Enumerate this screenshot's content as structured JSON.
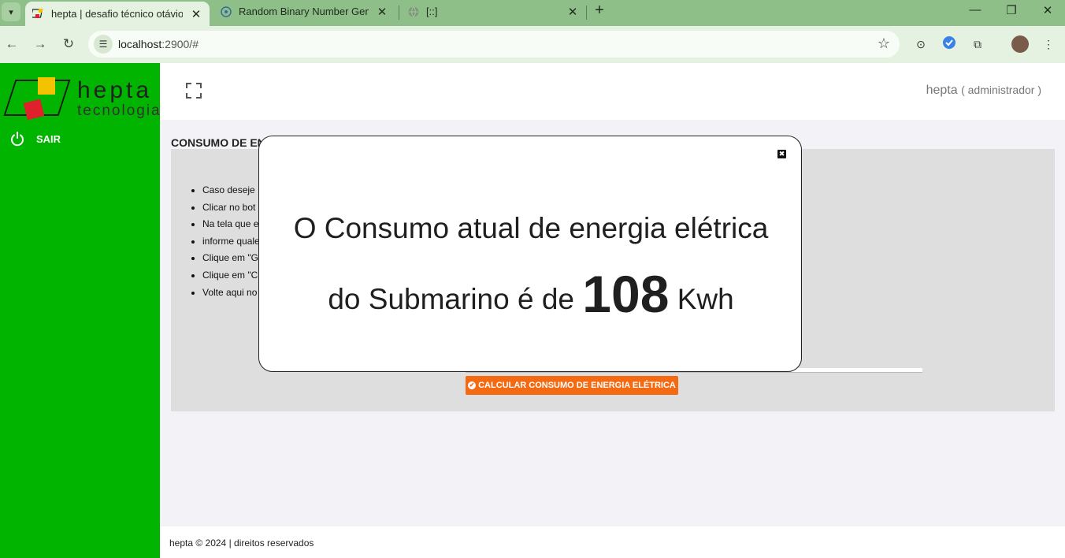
{
  "browser": {
    "tabs": [
      {
        "title": "hepta | desafio técnico otávio g",
        "active": true
      },
      {
        "title": "Random Binary Number Genera",
        "active": false
      },
      {
        "title": "[::]",
        "active": false
      }
    ],
    "new_tab": "+",
    "url_host": "localhost",
    "url_rest": ":2900/#"
  },
  "sidebar": {
    "logo_title": "hepta",
    "logo_subtitle": "tecnologia",
    "logout_label": "SAIR"
  },
  "header": {
    "user_name": "hepta",
    "user_role": "( administrador )"
  },
  "main": {
    "title": "CONSUMO DE EN",
    "instructions": [
      "Caso deseje",
      "Clicar no bot",
      "Na tela que e",
      "informe quale",
      "Clique em \"G",
      "Clique em \"C",
      "Volte aqui no"
    ],
    "calc_button": "CALCULAR CONSUMO DE ENERGIA ELÉTRICA"
  },
  "modal": {
    "line1": "O Consumo atual de energia elétrica",
    "line2_prefix": "do Submarino é de",
    "value": "108",
    "unit": "Kwh"
  },
  "footer": {
    "text": "hepta © 2024 | direitos reservados"
  },
  "colors": {
    "sidebar": "#00b400",
    "accent_button": "#f36a12",
    "tabbar": "#8fbf88"
  }
}
